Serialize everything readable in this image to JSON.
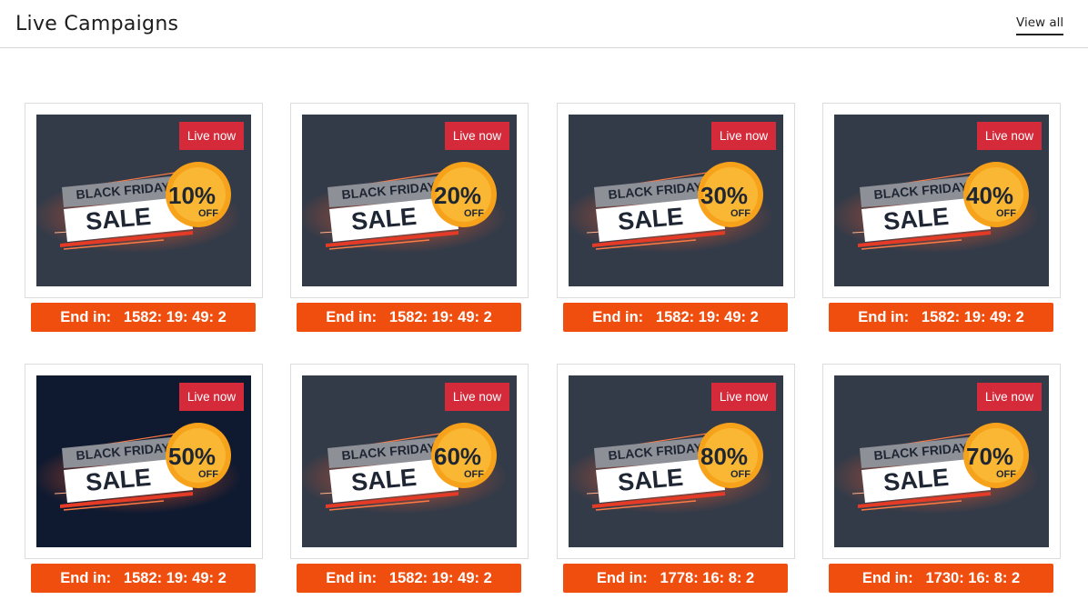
{
  "header": {
    "title": "Live Campaigns",
    "view_all_label": "View all"
  },
  "campaigns": [
    {
      "badge": "Live now",
      "banner_line1": "BLACK FRIDAY",
      "banner_line2": "SALE",
      "discount": "10%",
      "discount_suffix": "OFF",
      "timer_label": "End in:",
      "timer_value": "1582: 19: 49: 2"
    },
    {
      "badge": "Live now",
      "banner_line1": "BLACK FRIDAY",
      "banner_line2": "SALE",
      "discount": "20%",
      "discount_suffix": "OFF",
      "timer_label": "End in:",
      "timer_value": "1582: 19: 49: 2"
    },
    {
      "badge": "Live now",
      "banner_line1": "BLACK FRIDAY",
      "banner_line2": "SALE",
      "discount": "30%",
      "discount_suffix": "OFF",
      "timer_label": "End in:",
      "timer_value": "1582: 19: 49: 2"
    },
    {
      "badge": "Live now",
      "banner_line1": "BLACK FRIDAY",
      "banner_line2": "SALE",
      "discount": "40%",
      "discount_suffix": "OFF",
      "timer_label": "End in:",
      "timer_value": "1582: 19: 49: 2"
    },
    {
      "badge": "Live now",
      "banner_line1": "BLACK FRIDAY",
      "banner_line2": "SALE",
      "discount": "50%",
      "discount_suffix": "OFF",
      "timer_label": "End in:",
      "timer_value": "1582: 19: 49: 2"
    },
    {
      "badge": "Live now",
      "banner_line1": "BLACK FRIDAY",
      "banner_line2": "SALE",
      "discount": "60%",
      "discount_suffix": "OFF",
      "timer_label": "End in:",
      "timer_value": "1582: 19: 49: 2"
    },
    {
      "badge": "Live now",
      "banner_line1": "BLACK FRIDAY",
      "banner_line2": "SALE",
      "discount": "80%",
      "discount_suffix": "OFF",
      "timer_label": "End in:",
      "timer_value": "1778: 16: 8: 2"
    },
    {
      "badge": "Live now",
      "banner_line1": "BLACK FRIDAY",
      "banner_line2": "SALE",
      "discount": "70%",
      "discount_suffix": "OFF",
      "timer_label": "End in:",
      "timer_value": "1730: 16: 8: 2"
    }
  ],
  "colors": {
    "badge": "#d42a3a",
    "timer": "#f04e0f",
    "banner_bg": "#343b48",
    "banner_bg_dark": "#0f1a30",
    "starburst": "#f7a21b"
  }
}
